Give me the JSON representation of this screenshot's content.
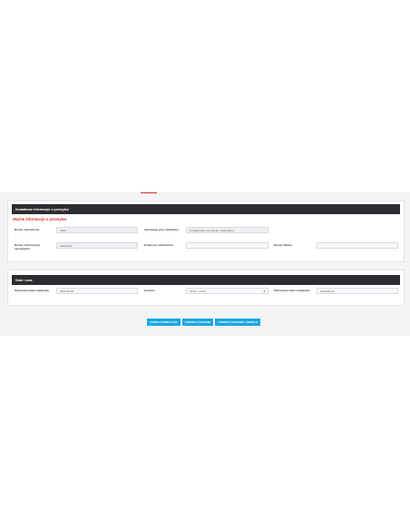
{
  "sections": {
    "additional": {
      "header": "Dodatkowe informacje o przesyłce",
      "subtitle": "Ważne informacje o przesyłce",
      "fields": {
        "order_number": {
          "label": "Numer zamówienia",
          "value": "4360"
        },
        "shipment_info": {
          "label": "Informacje przy zaladunku",
          "value": "Oznakuj auto na widoku, zabezpiecz"
        },
        "reference_number": {
          "label": "Numer referencyjny zamówienia",
          "value": "ZHE-2021"
        },
        "attached_documents": {
          "label": "Dołączone dokumenty",
          "value": ""
        },
        "invoice_number": {
          "label": "Numer faktury",
          "value": ""
        }
      }
    },
    "datetime": {
      "header": "Data i czas",
      "fields": {
        "planned_loading_date": {
          "label": "Planowana data załadunku",
          "value": "2020-08-02"
        },
        "hours": {
          "label": "Godzina",
          "value": "15:00 - 16:00"
        },
        "planned_unloading_date": {
          "label": "Planowana data rozładunku",
          "value": "2020-08-03"
        }
      }
    }
  },
  "buttons": {
    "save": "ZAPISZ FORMULARZ",
    "create_order": "UTWÓRZ ZLECENIE",
    "create_order_copy": "UTWÓRZ ZLECENIE I DRUKUJ"
  },
  "colors": {
    "accent_red": "#d32f2f",
    "header_dark": "#2b2d30",
    "button_blue": "#1aa7e0"
  }
}
